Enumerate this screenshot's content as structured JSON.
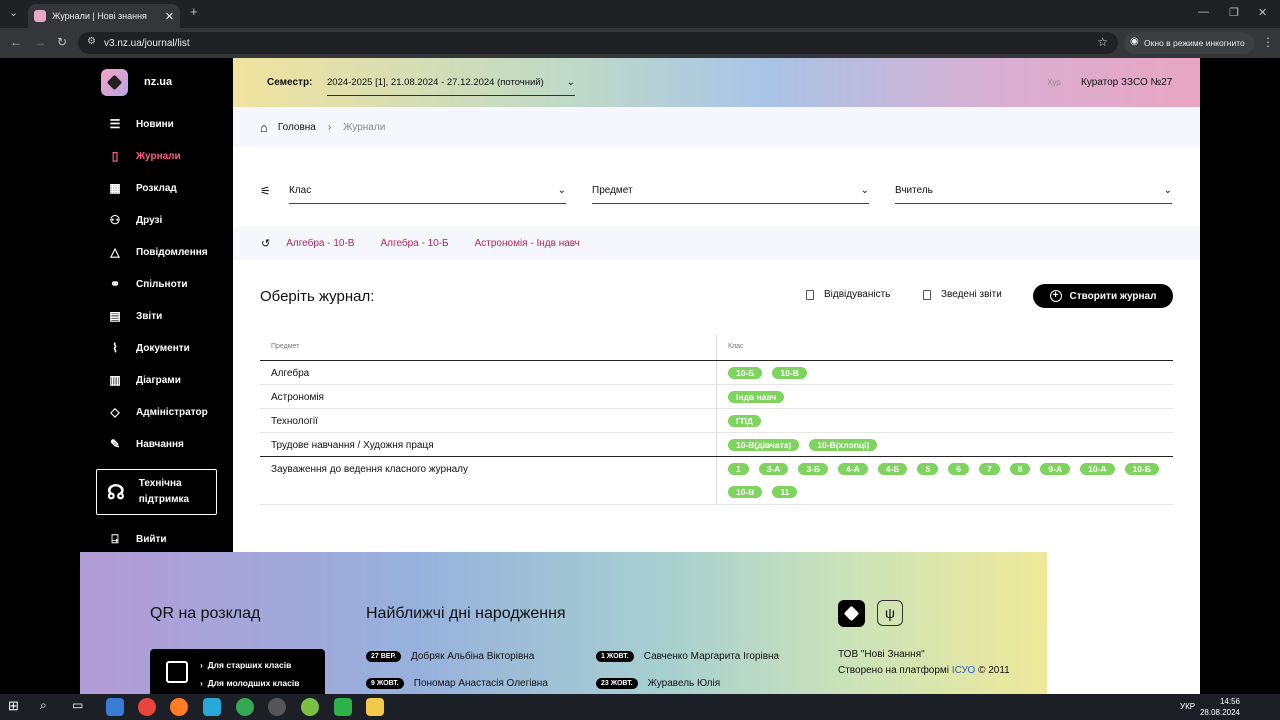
{
  "browser": {
    "tab_title": "Журнали | Нові знання",
    "url": "v3.nz.ua/journal/list",
    "incognito_label": "Окно в режиме инкогнито"
  },
  "sidebar": {
    "brand": "nz.ua",
    "items": [
      {
        "label": "Новини",
        "icon": "list-icon"
      },
      {
        "label": "Журнали",
        "icon": "journal-icon",
        "active": true
      },
      {
        "label": "Розклад",
        "icon": "calendar-icon"
      },
      {
        "label": "Друзі",
        "icon": "friends-icon"
      },
      {
        "label": "Повідомлення",
        "icon": "bell-icon"
      },
      {
        "label": "Спільноти",
        "icon": "communities-icon"
      },
      {
        "label": "Звіти",
        "icon": "report-icon"
      },
      {
        "label": "Документи",
        "icon": "paperclip-icon"
      },
      {
        "label": "Діаграми",
        "icon": "chart-icon"
      },
      {
        "label": "Адміністратор",
        "icon": "admin-icon"
      },
      {
        "label": "Навчання",
        "icon": "pencil-icon"
      }
    ],
    "support_label": "Технічна підтримка",
    "logout_label": "Вийти",
    "active_color": "#ff5b8a"
  },
  "topbar": {
    "semester_label": "Семестр:",
    "semester_value": "2024-2025 [1], 21.08.2024 - 27.12.2024 (поточний)",
    "avatar_alt": "Хур",
    "user_name": "Куратор ЗЗСО №27"
  },
  "breadcrumb": {
    "home": "Головна",
    "current": "Журнали"
  },
  "filters": {
    "class_label": "Клас",
    "subject_label": "Предмет",
    "teacher_label": "Вчитель"
  },
  "recent": [
    "Алгебра - 10-В",
    "Алгебра - 10-Б",
    "Астрономія - Індв навч"
  ],
  "actions": {
    "heading": "Оберіть журнал:",
    "attendance": "Відвідуваність",
    "summary_reports": "Зведені звіти",
    "create_journal": "Створити журнал"
  },
  "table": {
    "headers": {
      "subject": "Предмет",
      "class": "Клас"
    },
    "rows": [
      {
        "subject": "Алгебра",
        "classes": [
          "10-Б",
          "10-В"
        ]
      },
      {
        "subject": "Астрономія",
        "classes": [
          "Індв навч"
        ]
      },
      {
        "subject": "Технології",
        "classes": [
          "ГПД"
        ]
      },
      {
        "subject": "Трудове навчання / Художня праця",
        "classes": [
          "10-В(дівчата)",
          "10-В(хлопці)"
        ]
      },
      {
        "subject": "Зауваження до ведення класного журналу",
        "classes": [
          "1",
          "3-А",
          "3-Б",
          "4-А",
          "4-Б",
          "5",
          "6",
          "7",
          "8",
          "9-А",
          "10-А",
          "10-Б",
          "10-В",
          "11"
        ]
      }
    ],
    "badge_color": "#7fd35f"
  },
  "footer": {
    "qr_title": "QR на розклад",
    "qr_senior": "Для старших класів",
    "qr_junior": "Для молодших класів",
    "birthdays_title": "Найближчі дні народження",
    "birthdays": [
      {
        "date": "27 ВЕР.",
        "name": "Добряк Альбіна Вікторівна"
      },
      {
        "date": "1 ЖОВТ.",
        "name": "Савченко Маргарита Ігорівна"
      },
      {
        "date": "9 ЖОВТ.",
        "name": "Пономар Анастасія Олегівна"
      },
      {
        "date": "23 ЖОВТ.",
        "name": "Журавель Юлія"
      }
    ],
    "company": "ТОВ \"Нові Знання\"",
    "created_on": "Створено на платформі",
    "platform": "ІСУО",
    "copyright": "© 2011"
  },
  "taskbar": {
    "lang": "УКР",
    "time": "14:56",
    "date": "28.08.2024"
  }
}
